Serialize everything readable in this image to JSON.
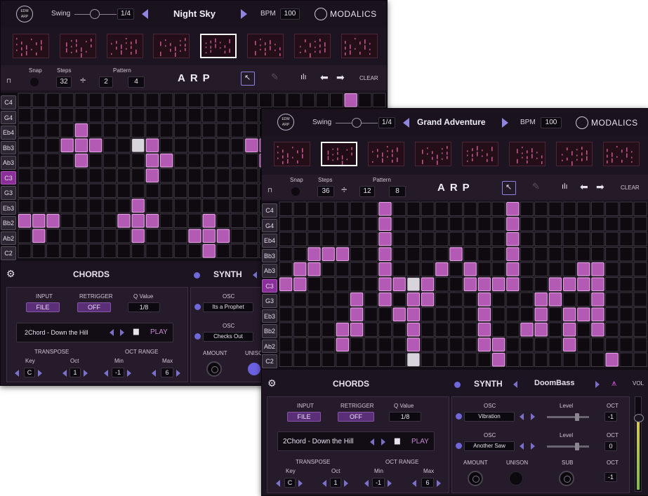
{
  "colors": {
    "note_on": "#b35bb4",
    "note_on_border": "#e8a0e6",
    "accent": "#8f84e0",
    "c3_highlight": "#8a2e9a"
  },
  "back": {
    "logo_line1": "EDM",
    "logo_line2": "ARP",
    "swing_label": "Swing",
    "swing_value": "1/4",
    "preset_name": "Night Sky",
    "bpm_label": "BPM",
    "bpm_value": "100",
    "brand": "MODALICS",
    "snap_label": "Snap",
    "steps_label": "Steps",
    "steps_value": "32",
    "divide_symbol": "÷",
    "div_value": "2",
    "pattern_label": "Pattern",
    "pattern_value": "4",
    "mode": "ARP",
    "clear_label": "CLEAR",
    "lock_icon": "lock-icon",
    "notes": [
      "C4",
      "G4",
      "Eb4",
      "Bb3",
      "Ab3",
      "C3",
      "G3",
      "Eb3",
      "Bb2",
      "Ab2",
      "C2"
    ],
    "chords_title": "CHORDS",
    "synth_title": "SYNTH",
    "input_label": "INPUT",
    "input_value": "FILE",
    "retrigger_label": "RETRIGGER",
    "retrigger_value": "OFF",
    "qvalue_label": "Q Value",
    "qvalue_value": "1/8",
    "osc_label": "OSC",
    "osc1_value": "Its a Prophet",
    "osc2_value": "Checks Out",
    "chord_file": "2Chord - Down the Hill",
    "play_label": "PLAY",
    "transpose_label": "TRANSPOSE",
    "key_label": "Key",
    "key_value": "C",
    "oct_label": "Oct",
    "oct_value": "1",
    "oct_range_label": "OCT RANGE",
    "min_label": "Min",
    "min_value": "-1",
    "max_label": "Max",
    "max_value": "6",
    "amount_label": "AMOUNT",
    "unison_label": "UNISO"
  },
  "front": {
    "logo_line1": "EDM",
    "logo_line2": "ARP",
    "swing_label": "Swing",
    "swing_value": "1/4",
    "preset_name": "Grand Adventure",
    "bpm_label": "BPM",
    "bpm_value": "100",
    "brand": "MODALICS",
    "snap_label": "Snap",
    "steps_label": "Steps",
    "steps_value": "36",
    "divide_symbol": "÷",
    "div_value": "12",
    "pattern_label": "Pattern",
    "pattern_value": "8",
    "mode": "ARP",
    "clear_label": "CLEAR",
    "lock_icon": "lock-icon",
    "notes": [
      "C4",
      "G4",
      "Eb4",
      "Bb3",
      "Ab3",
      "C3",
      "G3",
      "Eb3",
      "Bb2",
      "Ab2",
      "C2"
    ],
    "chords_title": "CHORDS",
    "synth_title": "SYNTH",
    "synth_preset": "DoomBass",
    "vol_label": "VOL",
    "input_label": "INPUT",
    "input_value": "FILE",
    "retrigger_label": "RETRIGGER",
    "retrigger_value": "OFF",
    "qvalue_label": "Q Value",
    "qvalue_value": "1/8",
    "osc_label": "OSC",
    "osc1_value": "Vibration",
    "osc2_value": "Another Saw",
    "level_label": "Level",
    "oct_label": "OCT",
    "osc1_oct": "-1",
    "osc2_oct": "0",
    "chord_file": "2Chord - Down the Hill",
    "play_label": "PLAY",
    "transpose_label": "TRANSPOSE",
    "key_label": "Key",
    "key_value": "C",
    "trans_oct_label": "Oct",
    "trans_oct_value": "1",
    "oct_range_label": "OCT RANGE",
    "min_label": "Min",
    "min_value": "-1",
    "max_label": "Max",
    "max_value": "6",
    "amount_label": "AMOUNT",
    "unison_label": "UNISON",
    "sub_label": "SUB",
    "sub_oct_label": "OCT",
    "sub_oct_value": "-1"
  }
}
